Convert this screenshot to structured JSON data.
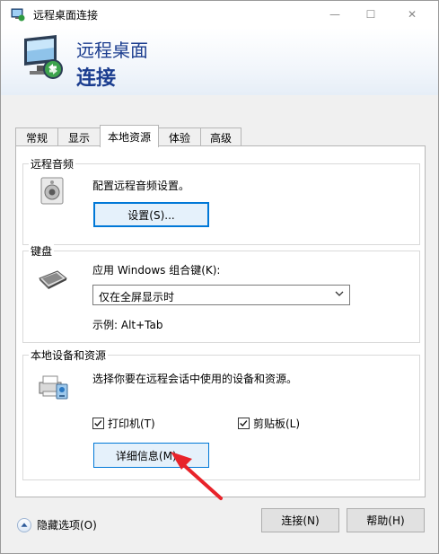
{
  "window": {
    "title": "远程桌面连接",
    "minimize": "—",
    "maximize": "☐",
    "close": "✕"
  },
  "banner": {
    "line1": "远程桌面",
    "line2": "连接"
  },
  "tabs": [
    {
      "label": "常规"
    },
    {
      "label": "显示"
    },
    {
      "label": "本地资源"
    },
    {
      "label": "体验"
    },
    {
      "label": "高级"
    }
  ],
  "audio": {
    "legend": "远程音频",
    "description": "配置远程音频设置。",
    "settings_button": "设置(S)..."
  },
  "keyboard": {
    "legend": "键盘",
    "apply_label": "应用 Windows 组合键(K):",
    "selected_option": "仅在全屏显示时",
    "example": "示例: Alt+Tab"
  },
  "devices": {
    "legend": "本地设备和资源",
    "description": "选择你要在远程会话中使用的设备和资源。",
    "printer_label": "打印机(T)",
    "clipboard_label": "剪贴板(L)",
    "details_button": "详细信息(M)..."
  },
  "footer": {
    "hide_options": "隐藏选项(O)",
    "connect_button": "连接(N)",
    "help_button": "帮助(H)"
  },
  "colors": {
    "accent": "#0078d7",
    "banner_text": "#1b3d8f",
    "annotation_arrow": "#e8232a"
  }
}
